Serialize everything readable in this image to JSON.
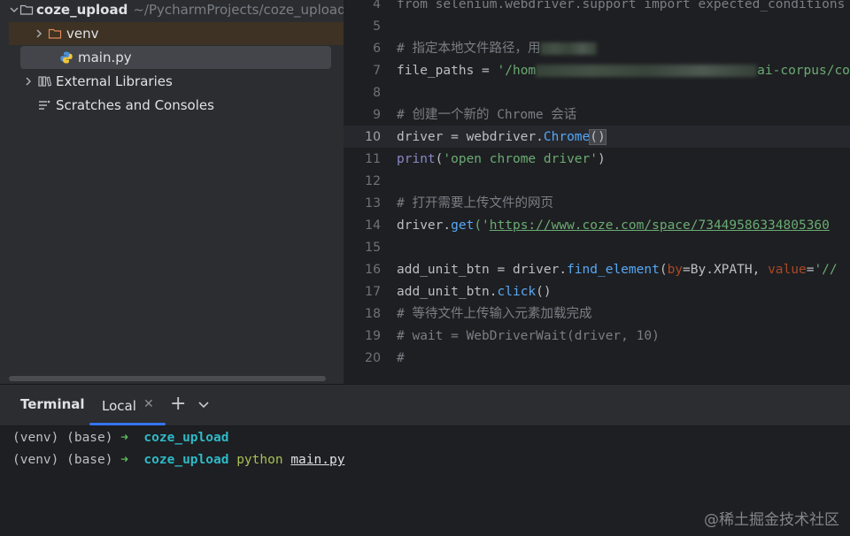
{
  "project": {
    "root_name": "coze_upload",
    "root_path": "~/PycharmProjects/coze_upload",
    "items": [
      {
        "label": "venv",
        "type": "folder"
      },
      {
        "label": "main.py",
        "type": "python-file"
      },
      {
        "label": "External Libraries",
        "type": "library"
      },
      {
        "label": "Scratches and Consoles",
        "type": "scratches"
      }
    ]
  },
  "editor": {
    "current_line": "10",
    "line_numbers": [
      "4",
      "5",
      "6",
      "7",
      "8",
      "9",
      "10",
      "11",
      "12",
      "13",
      "14",
      "15",
      "16",
      "17",
      "18",
      "19",
      "20"
    ],
    "lines": {
      "l4": "from selenium.webdriver.support import expected_conditions",
      "l6": "# 指定本地文件路径，用",
      "l7_a": "file_paths = ",
      "l7_b": "'/hom",
      "l7_c": "ai-corpus/corp",
      "l9": "# 创建一个新的 Chrome 会话",
      "l10_a": "driver = webdriver.",
      "l10_b": "Chrome",
      "l10_c": "()",
      "l11_a": "print",
      "l11_b": "(",
      "l11_c": "'open chrome driver'",
      "l11_d": ")",
      "l13": "# 打开需要上传文件的网页",
      "l14_a": "driver.",
      "l14_b": "get",
      "l14_c": "('",
      "l14_d": "https://www.coze.com/space/73449586334805360",
      "l16_a": "add_unit_btn = driver.",
      "l16_b": "find_element",
      "l16_c": "(",
      "l16_d": "by",
      "l16_e": "=By.XPATH, ",
      "l16_f": "value",
      "l16_g": "=",
      "l16_h": "'//",
      "l17_a": "add_unit_btn.",
      "l17_b": "click",
      "l17_c": "()",
      "l18": "# 等待文件上传输入元素加载完成",
      "l19": "# wait = WebDriverWait(driver, 10)",
      "l20": "#"
    }
  },
  "terminal": {
    "title": "Terminal",
    "tab_label": "Local",
    "lines": [
      {
        "prefix": "(venv) (base) ",
        "arrow": "➜",
        "dir": "coze_upload",
        "cmd": "",
        "arg": ""
      },
      {
        "prefix": "(venv) (base) ",
        "arrow": "➜",
        "dir": "coze_upload",
        "cmd": "python",
        "arg": "main.py"
      }
    ]
  },
  "watermark": "@稀土掘金技术社区"
}
